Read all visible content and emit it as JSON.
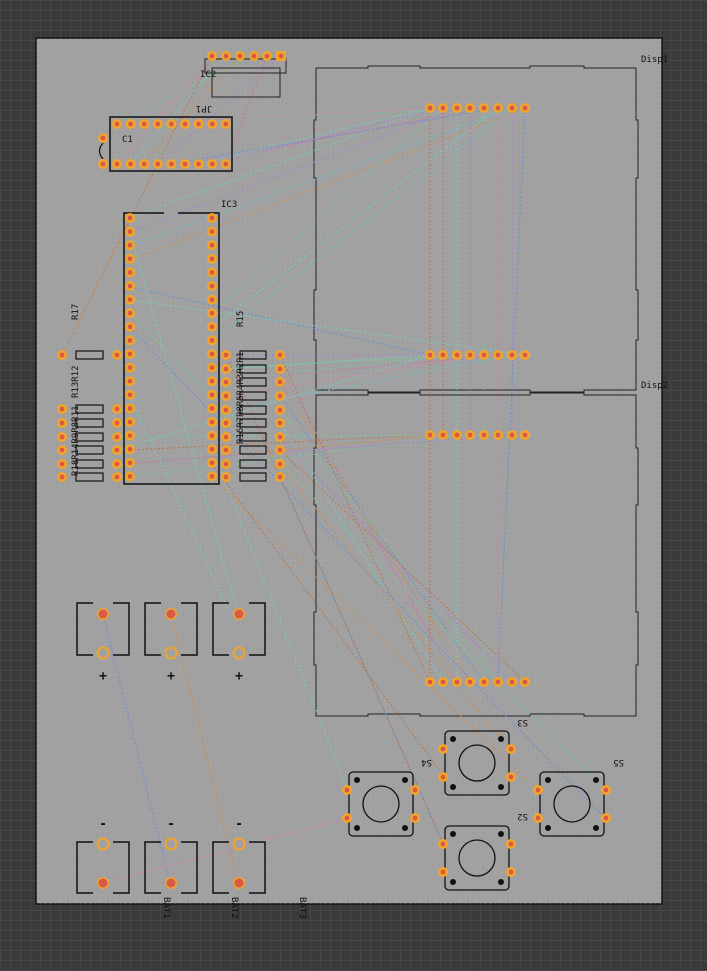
{
  "board": {
    "bg": "#a0a0a0",
    "grid": "#adadad",
    "outline": "#111111",
    "silk": "#111111"
  },
  "colors": {
    "pad_ring": "#f2a42c",
    "pad_center": "#d65a48",
    "copper_bg": "#4a4a4a"
  },
  "labels": {
    "ic2": "IC2",
    "jp1": "JP1",
    "c1": "C1",
    "ic3": "IC3",
    "r17": "R17",
    "r15": "R15",
    "r13r12": "R13R12",
    "left_stack": "R18R14R9R8R11",
    "right_stack": "R16R7R8R5R4R3R2R1",
    "disp1": "Disp1",
    "disp2": "Disp2",
    "s2": "S2",
    "s3": "S3",
    "s4": "S4",
    "s5": "S5",
    "bat1": "BAT1",
    "bat2": "BAT2",
    "bat3": "BAT3",
    "plus": "+",
    "minus": "-"
  }
}
